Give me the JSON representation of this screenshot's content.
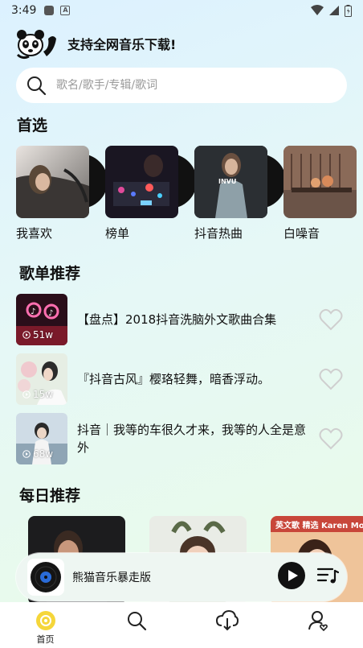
{
  "status": {
    "time": "3:49"
  },
  "header": {
    "slogan": "支持全网音乐下载!"
  },
  "search": {
    "placeholder": "歌名/歌手/专辑/歌词"
  },
  "sections": {
    "picks": "首选",
    "playlists": "歌单推荐",
    "daily": "每日推荐"
  },
  "picks": [
    {
      "label": "我喜欢"
    },
    {
      "label": "榜单"
    },
    {
      "label": "抖音热曲",
      "cover_text": "INVU"
    },
    {
      "label": "白噪音"
    }
  ],
  "playlists": [
    {
      "title": "【盘点】2018抖音洗脑外文歌曲合集",
      "count": "51w"
    },
    {
      "title": "『抖音古风』樱珞轻舞，暗香浮动。",
      "count": "15w"
    },
    {
      "title": "抖音｜我等的车很久才来，我等的人全是意外",
      "count": "68w"
    }
  ],
  "daily": [
    {
      "cover_text": ""
    },
    {
      "cover_text": ""
    },
    {
      "cover_text": "英文歌 精选  Karen Mo"
    }
  ],
  "player": {
    "song": "熊猫音乐暴走版"
  },
  "tabs": [
    {
      "label": "首页",
      "icon": "home-icon",
      "active": true
    },
    {
      "label": "",
      "icon": "search-icon"
    },
    {
      "label": "",
      "icon": "download-icon"
    },
    {
      "label": "",
      "icon": "profile-icon"
    }
  ],
  "colors": {
    "accent": "#f5d63a",
    "heart": "#cfcfcf"
  }
}
